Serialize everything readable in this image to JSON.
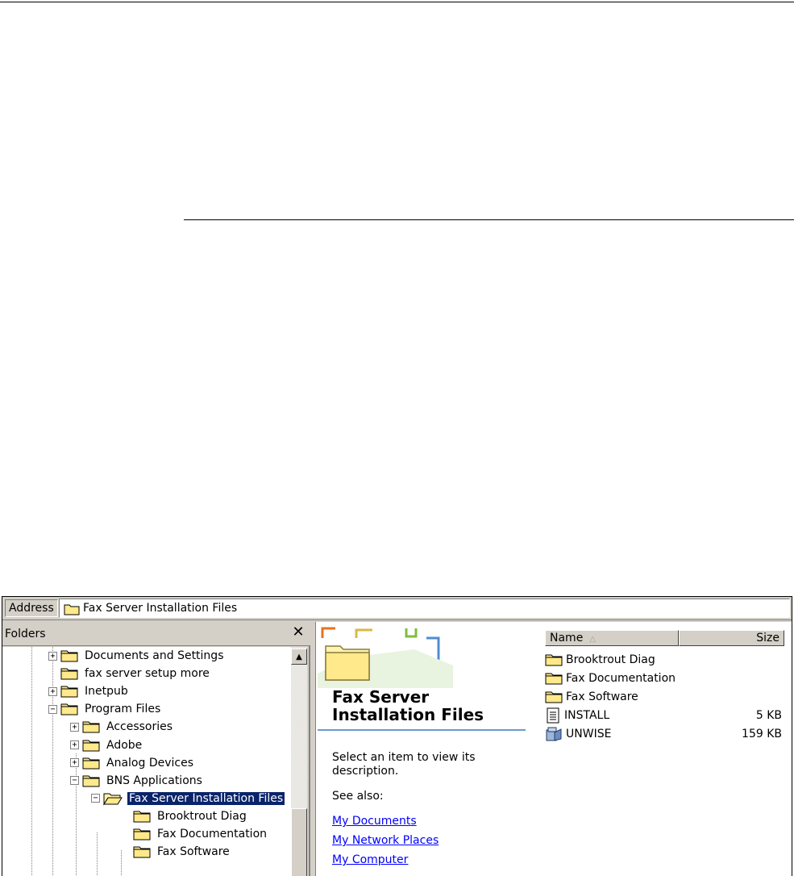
{
  "address": {
    "label": "Address",
    "value": "Fax Server Installation Files"
  },
  "folders_pane": {
    "title": "Folders",
    "close": "✕",
    "tree": [
      {
        "label": "Documents and Settings",
        "expander": "+",
        "level": 2
      },
      {
        "label": "fax server setup more",
        "expander": "",
        "level": 2
      },
      {
        "label": "Inetpub",
        "expander": "+",
        "level": 2
      },
      {
        "label": "Program Files",
        "expander": "−",
        "level": 2
      },
      {
        "label": "Accessories",
        "expander": "+",
        "level": 3
      },
      {
        "label": "Adobe",
        "expander": "+",
        "level": 3
      },
      {
        "label": "Analog Devices",
        "expander": "+",
        "level": 3
      },
      {
        "label": "BNS Applications",
        "expander": "−",
        "level": 3
      },
      {
        "label": "Fax Server Installation Files",
        "expander": "−",
        "level": 4,
        "selected": true,
        "open": true
      },
      {
        "label": "Brooktrout Diag",
        "expander": "",
        "level": 5
      },
      {
        "label": "Fax Documentation",
        "expander": "",
        "level": 5
      },
      {
        "label": "Fax Software",
        "expander": "",
        "level": 5
      }
    ]
  },
  "webview": {
    "title_line1": "Fax Server",
    "title_line2": "Installation Files",
    "description": "Select an item to view its description.",
    "see_also": "See also:",
    "links": [
      "My Documents",
      "My Network Places",
      "My Computer"
    ]
  },
  "filelist": {
    "columns": {
      "name": "Name",
      "size": "Size"
    },
    "files": [
      {
        "name": "Brooktrout Diag",
        "size": "",
        "icon": "folder-icon"
      },
      {
        "name": "Fax Documentation",
        "size": "",
        "icon": "folder-icon"
      },
      {
        "name": "Fax Software",
        "size": "",
        "icon": "folder-icon"
      },
      {
        "name": "INSTALL",
        "size": "5 KB",
        "icon": "text-document-icon"
      },
      {
        "name": "UNWISE",
        "size": "159 KB",
        "icon": "uninstaller-icon"
      }
    ]
  },
  "colors": {
    "selection": "#0a246a",
    "link": "#0000ff",
    "window": "#d4d0c8"
  }
}
